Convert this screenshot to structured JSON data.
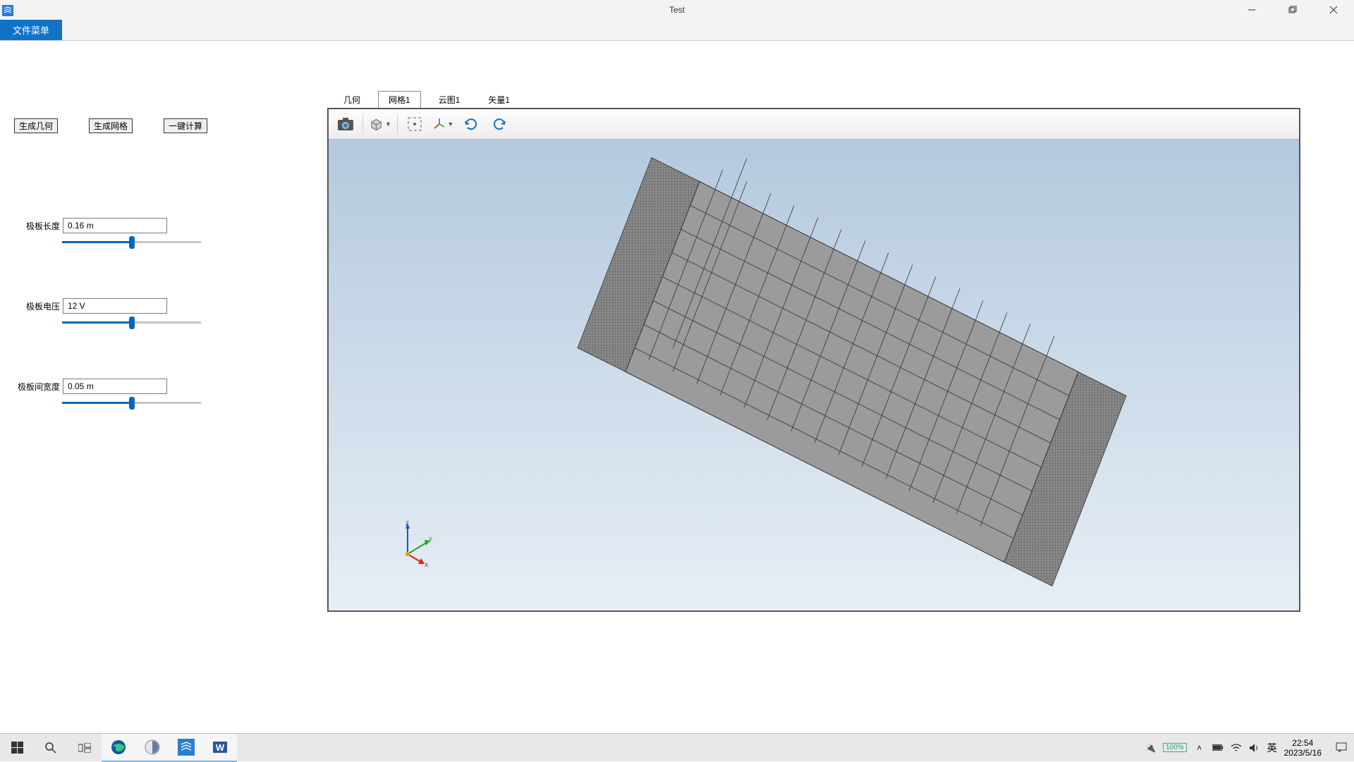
{
  "window": {
    "title": "Test"
  },
  "menubar": {
    "file_menu": "文件菜单"
  },
  "left_panel": {
    "buttons": {
      "gen_geom": "生成几何",
      "gen_mesh": "生成网格",
      "one_click": "一键计算"
    },
    "params": [
      {
        "label": "极板长度",
        "value": "0.16 m",
        "slider_pct": 50
      },
      {
        "label": "极板电压",
        "value": "12 V",
        "slider_pct": 50
      },
      {
        "label": "极板间宽度",
        "value": "0.05 m",
        "slider_pct": 50
      }
    ]
  },
  "view": {
    "tabs": [
      "几何",
      "网格1",
      "云图1",
      "矢量1"
    ],
    "active_tab_index": 1
  },
  "triad": {
    "x": "x",
    "y": "y",
    "z": "z"
  },
  "systray": {
    "battery_pct": "100%",
    "ime": "英",
    "time": "22:54",
    "date": "2023/5/16"
  }
}
